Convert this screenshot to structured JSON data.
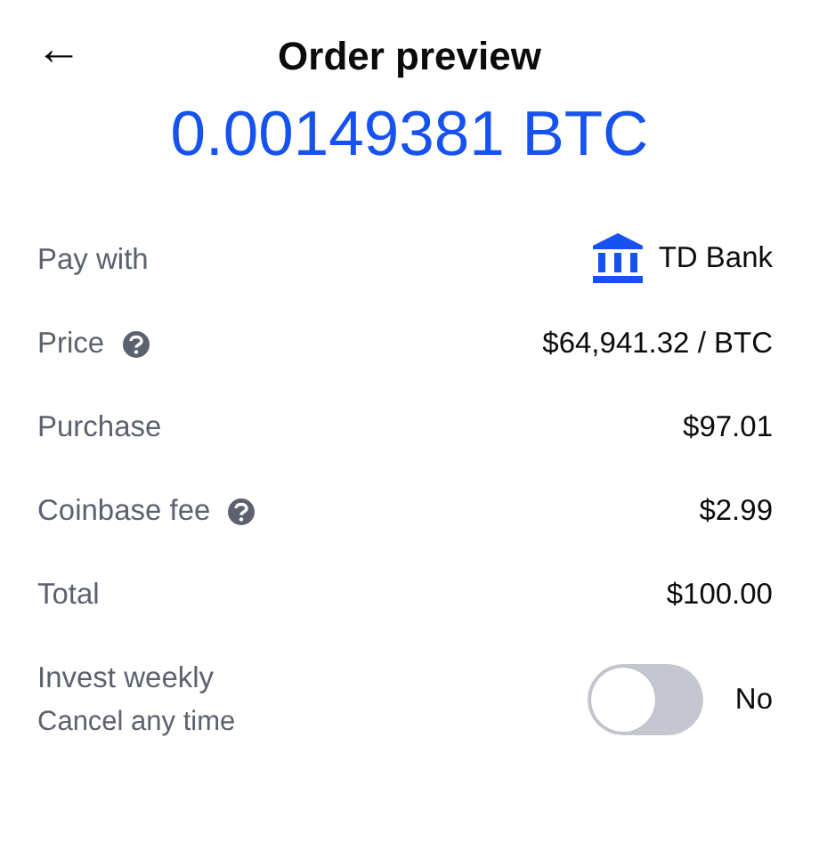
{
  "header": {
    "back": "←",
    "title": "Order preview"
  },
  "amount": "0.00149381 BTC",
  "details": [
    {
      "kind": "bank",
      "label": "Pay with",
      "help": false,
      "value": "TD Bank"
    },
    {
      "kind": "plain",
      "label": "Price",
      "help": true,
      "value": "$64,941.32 / BTC"
    },
    {
      "kind": "plain",
      "label": "Purchase",
      "help": false,
      "value": "$97.01"
    },
    {
      "kind": "plain",
      "label": "Coinbase fee",
      "help": true,
      "value": "$2.99"
    },
    {
      "kind": "plain",
      "label": "Total",
      "help": false,
      "value": "$100.00"
    }
  ],
  "recurring": {
    "label": "Invest weekly",
    "sublabel": "Cancel any time",
    "on": false,
    "state": "No"
  }
}
